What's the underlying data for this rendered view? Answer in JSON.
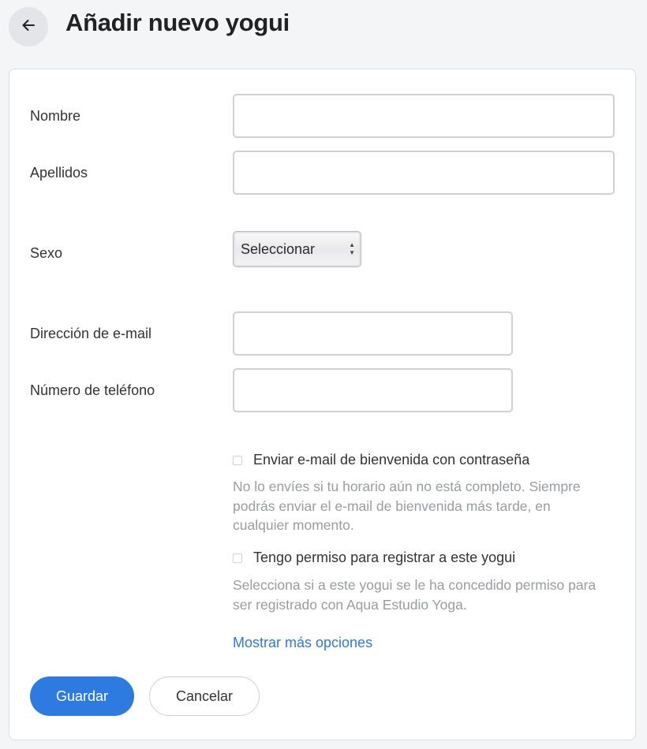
{
  "header": {
    "title": "Añadir nuevo yogui",
    "back_icon": "arrow-left-icon"
  },
  "form": {
    "nombre": {
      "label": "Nombre",
      "value": "",
      "placeholder": ""
    },
    "apellidos": {
      "label": "Apellidos",
      "value": "",
      "placeholder": ""
    },
    "sexo": {
      "label": "Sexo",
      "selected": "Seleccionar"
    },
    "email": {
      "label": "Dirección de e-mail",
      "value": "",
      "placeholder": ""
    },
    "telefono": {
      "label": "Número de teléfono",
      "value": "",
      "placeholder": ""
    },
    "welcome_email": {
      "label": "Enviar e-mail de bienvenida con contraseña",
      "checked": false,
      "help": "No lo envíes si tu horario aún no está completo. Siempre podrás enviar el e-mail de bienvenida más tarde, en cualquier momento."
    },
    "permission": {
      "label": "Tengo permiso para registrar a este yogui",
      "checked": false,
      "help": "Selecciona si a este yogui se le ha concedido permiso para ser registrado con Aqua Estudio Yoga."
    },
    "more_options": "Mostrar más opciones",
    "save_label": "Guardar",
    "cancel_label": "Cancelar"
  },
  "colors": {
    "primary": "#2d7be0",
    "link": "#2b79e0",
    "help_text": "#9a9ca0",
    "background": "#f4f5f7"
  }
}
